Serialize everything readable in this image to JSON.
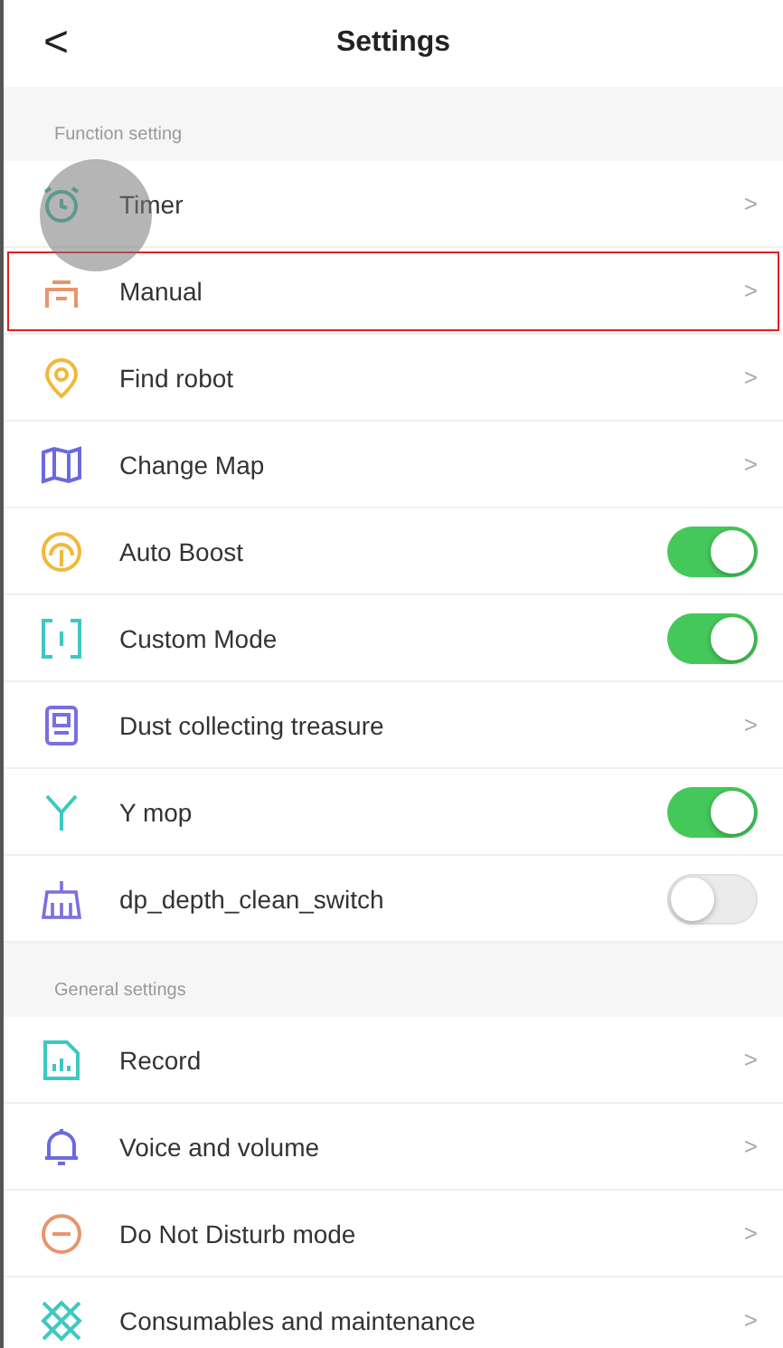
{
  "header": {
    "back": "<",
    "title": "Settings"
  },
  "sections": [
    {
      "label": "Function setting",
      "items": [
        {
          "label": "Timer",
          "kind": "link",
          "highlighted": false,
          "chevron": ">"
        },
        {
          "label": "Manual",
          "kind": "link",
          "highlighted": true,
          "chevron": ">"
        },
        {
          "label": "Find robot",
          "kind": "link",
          "highlighted": false,
          "chevron": ">"
        },
        {
          "label": "Change Map",
          "kind": "link",
          "highlighted": false,
          "chevron": ">"
        },
        {
          "label": "Auto Boost",
          "kind": "toggle",
          "highlighted": false,
          "on": true
        },
        {
          "label": "Custom Mode",
          "kind": "toggle",
          "highlighted": false,
          "on": true
        },
        {
          "label": "Dust collecting treasure",
          "kind": "link",
          "highlighted": false,
          "chevron": ">"
        },
        {
          "label": "Y mop",
          "kind": "toggle",
          "highlighted": false,
          "on": true
        },
        {
          "label": "dp_depth_clean_switch",
          "kind": "toggle",
          "highlighted": false,
          "on": false
        }
      ]
    },
    {
      "label": "General settings",
      "items": [
        {
          "label": "Record",
          "kind": "link",
          "highlighted": false,
          "chevron": ">"
        },
        {
          "label": "Voice and volume",
          "kind": "link",
          "highlighted": false,
          "chevron": ">"
        },
        {
          "label": "Do Not Disturb mode",
          "kind": "link",
          "highlighted": false,
          "chevron": ">"
        },
        {
          "label": "Consumables and maintenance",
          "kind": "link",
          "highlighted": false,
          "chevron": ">"
        }
      ]
    }
  ]
}
